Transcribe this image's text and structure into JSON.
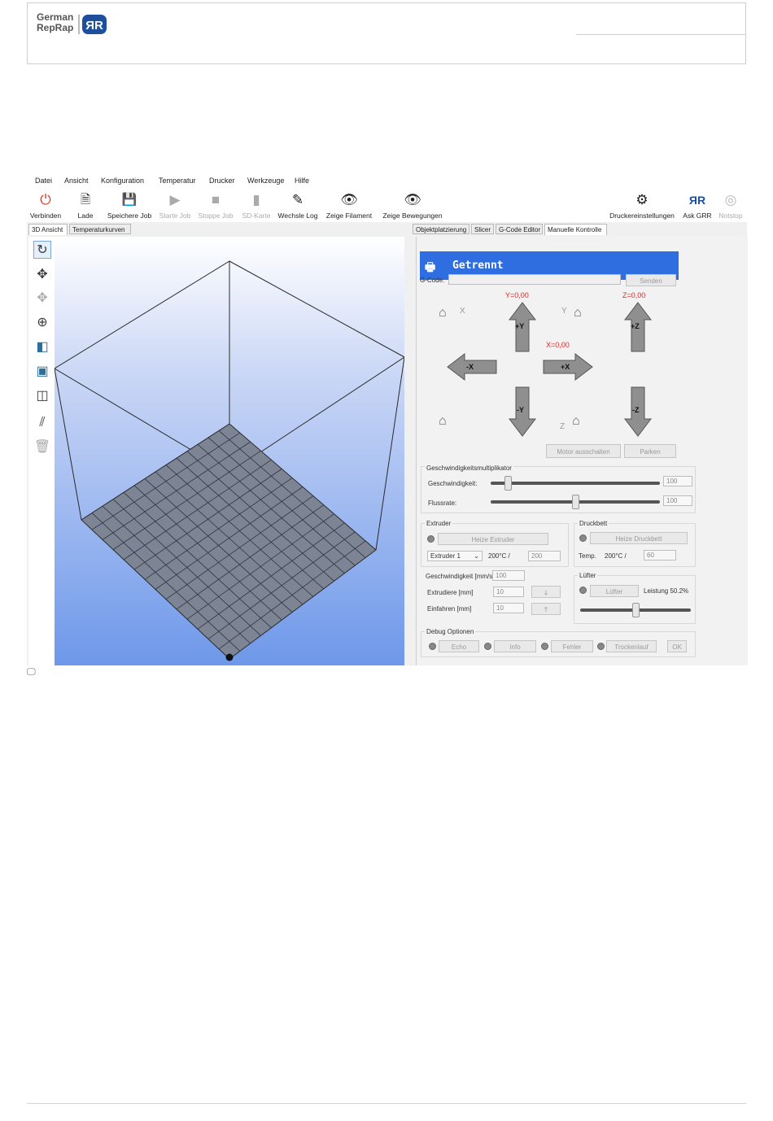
{
  "header": {
    "logo_line1": "German",
    "logo_line2": "RepRap"
  },
  "menu": [
    "Datei",
    "Ansicht",
    "Konfiguration",
    "Temperatur",
    "Drucker",
    "Werkzeuge",
    "Hilfe"
  ],
  "toolbar": {
    "connect": "Verbinden",
    "load": "Lade",
    "save_job": "Speichere Job",
    "start_job": "Starte Job",
    "stop_job": "Stoppe Job",
    "sd_card": "SD-Karte",
    "toggle_log": "Wechsle Log",
    "show_filament": "Zeige Filament",
    "show_moves": "Zeige Bewegungen",
    "printer_settings": "Druckereinstellungen",
    "ask_grr": "Ask GRR",
    "emergency_stop": "Notstop"
  },
  "left_tabs": [
    "3D Ansicht",
    "Temperaturkurven"
  ],
  "right_tabs": [
    "Objektplatzierung",
    "Slicer",
    "G-Code Editor",
    "Manuelle Kontrolle"
  ],
  "connection_status": "Getrennt",
  "gcode": {
    "label": "G-Code:",
    "send": "Senden"
  },
  "coords": {
    "x": "X=0,00",
    "y": "Y=0,00",
    "z": "Z=0,00"
  },
  "axes": {
    "x": "X",
    "y": "Y",
    "z": "Z"
  },
  "jog": {
    "plus_y": "+Y",
    "minus_y": "-Y",
    "plus_x": "+X",
    "minus_x": "-X",
    "plus_z": "+Z",
    "minus_z": "-Z"
  },
  "buttons": {
    "motor_off": "Motor ausschalten",
    "park": "Parken"
  },
  "speed": {
    "title": "Geschwindigkeitsmultiplikator",
    "speed_label": "Geschwindigkeit:",
    "speed_value": "100",
    "speed_level": 0.1,
    "flow_label": "Flussrate:",
    "flow_value": "100",
    "flow_level": 0.5
  },
  "extruder": {
    "title": "Extruder",
    "heat": "Heize Extruder",
    "select": "Extruder 1",
    "temp": "200°C /",
    "target": "200",
    "speed_label": "Geschwindigkeit [mm/s]",
    "speed_value": "100",
    "extrude_label": "Extrudiere [mm]",
    "extrude_value": "10",
    "retract_label": "Einfahren [mm]",
    "retract_value": "10"
  },
  "bed": {
    "title": "Druckbett",
    "heat": "Heize Druckbett",
    "temp_label": "Temp.",
    "temp": "200°C /",
    "target": "60"
  },
  "fan": {
    "title": "Lüfter",
    "button": "Lüfter",
    "power": "Leistung 50.2%",
    "level": 0.502
  },
  "debug": {
    "title": "Debug Optionen",
    "echo": "Echo",
    "info": "Info",
    "error": "Fehler",
    "dry_run": "Trockenlauf",
    "ok": "OK"
  }
}
